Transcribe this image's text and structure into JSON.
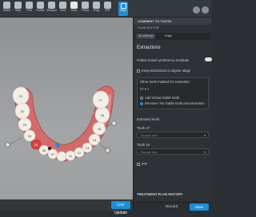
{
  "toolbar": {
    "tools": [
      {
        "label": "Select",
        "icon": "cursor-icon"
      },
      {
        "label": "Step",
        "icon": "step-icon"
      },
      {
        "label": "Grid",
        "icon": "grid-icon"
      },
      {
        "label": "Rotate",
        "icon": "rotate-icon"
      },
      {
        "label": "Measure",
        "icon": "ruler-icon"
      },
      {
        "label": "View",
        "icon": "eye-icon"
      },
      {
        "label": "Tabs",
        "icon": "tabs-icon"
      },
      {
        "label": "Points",
        "icon": "points-icon"
      },
      {
        "label": "Snap",
        "icon": "magnet-icon"
      },
      {
        "label": "IPR",
        "icon": "ipr-icon"
      },
      {
        "label": "Arch",
        "icon": "arch-icon"
      }
    ],
    "active_tool": "Tabs",
    "save_label": "Save"
  },
  "viewport": {
    "live_label": "Live Update"
  },
  "panel": {
    "header": "COMMENT TO TOOTH",
    "plan_title": "PLAN EDITOR",
    "tabs": [
      "All settings",
      "Edge"
    ],
    "section_title": "Extractions",
    "follow_label": "Follow chosen preference template",
    "keep_label": "Keep extractions to aligner stage",
    "other_title": "Other teeth marked for extraction:",
    "tooth_value": "27",
    "add_virtual": "Add Virtual Gable tooth",
    "remove_label": "Remove / No Gable tooth preconnection",
    "extracted_title": "Extracted teeth",
    "tooth_from": "Tooth 27",
    "choose1": "Choose one",
    "tooth_to": "Tooth 16",
    "choose2": "Choose one",
    "ipr_label": "IPR",
    "history_title": "TREATMENT PLAN HISTORY",
    "discard_label": "Discard",
    "save_label": "Save"
  },
  "teeth_labels": [
    "21",
    "22",
    "23",
    "24",
    "25",
    "26",
    "27",
    "11",
    "12",
    "13",
    "14",
    "15",
    "16",
    "17"
  ],
  "colors": {
    "accent": "#1c8fd8",
    "tooth": "#f4efe6",
    "gum": "#d46a6a"
  }
}
